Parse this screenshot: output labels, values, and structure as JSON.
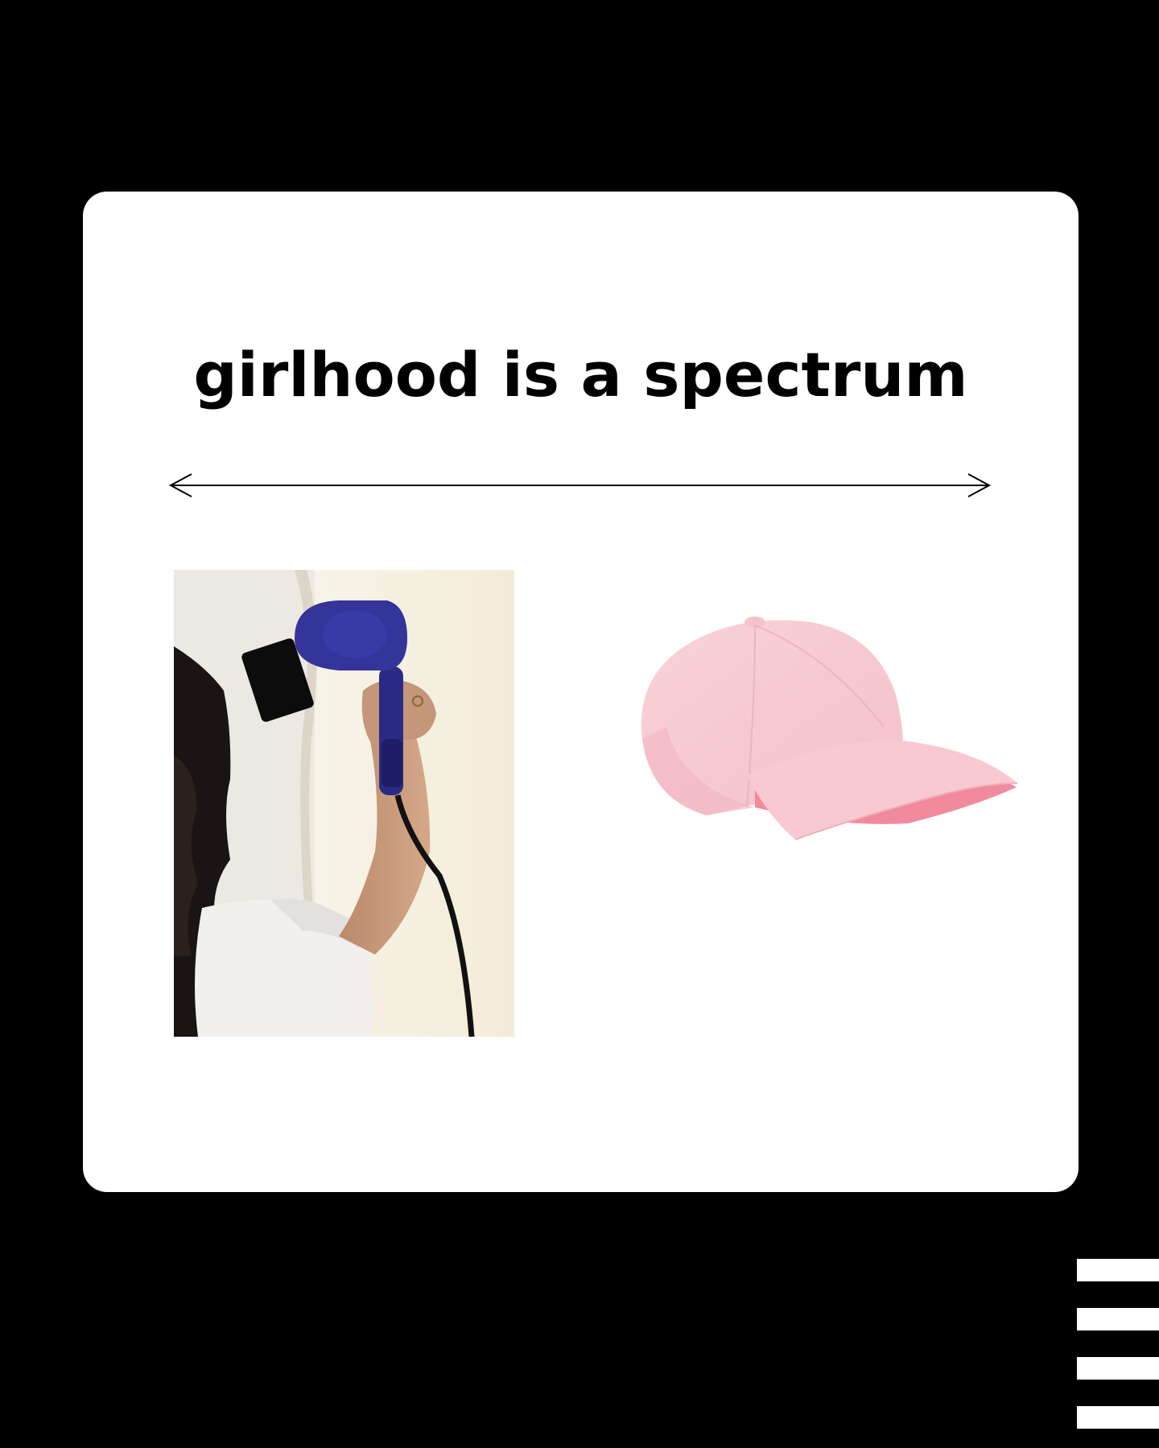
{
  "card": {
    "headline": "girlhood is a spectrum"
  },
  "colors": {
    "background": "#000000",
    "card": "#ffffff",
    "text": "#000000",
    "cap_pink": "#f7c6cf",
    "dryer_blue": "#2e2e8c"
  },
  "images": {
    "left": "hair-dryer-photo",
    "right": "pink-baseball-cap"
  },
  "decor": {
    "stripe_count": 4,
    "stripe_color": "#ffffff"
  }
}
